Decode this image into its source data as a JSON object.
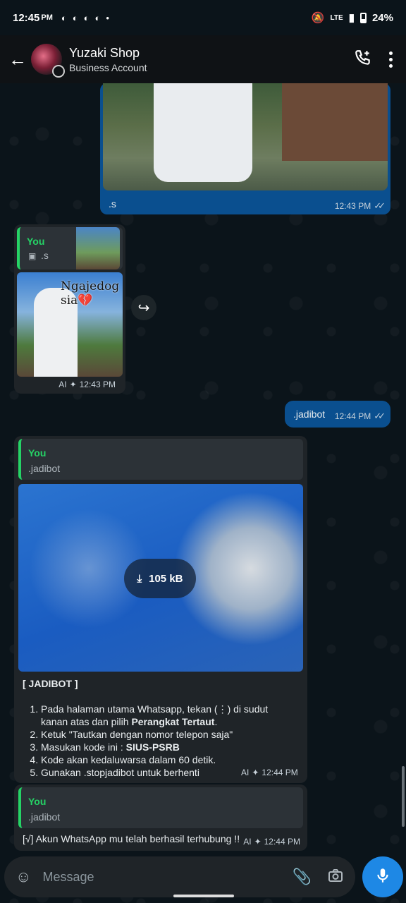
{
  "status": {
    "time": "12:45",
    "ampm": "PM",
    "battery": "24%",
    "network": "LTE"
  },
  "header": {
    "name": "Yuzaki Shop",
    "subtitle": "Business Account"
  },
  "messages": {
    "m1": {
      "caption": ".s",
      "time": "12:43 PM"
    },
    "m2": {
      "quote_who": "You",
      "quote_text": ".s",
      "image_text": "Ngajedog sia💔",
      "meta_ai": "AI",
      "time": "12:43 PM"
    },
    "m3": {
      "text": ".jadibot",
      "time": "12:44 PM"
    },
    "m4": {
      "quote_who": "You",
      "quote_text": ".jadibot",
      "download_size": "105 kB",
      "title": "[ JADIBOT ]",
      "steps": [
        {
          "pre": "Pada halaman utama Whatsapp, tekan (⋮) di sudut kanan atas dan pilih ",
          "bold": "Perangkat Tertaut",
          "post": "."
        },
        {
          "pre": "Ketuk \"Tautkan dengan nomor telepon saja\"",
          "bold": "",
          "post": ""
        },
        {
          "pre": "Masukan kode ini : ",
          "bold": "SIUS-PSRB",
          "post": ""
        },
        {
          "pre": "Kode akan kedaluwarsa dalam 60 detik.",
          "bold": "",
          "post": ""
        },
        {
          "pre": "Gunakan .stopjadibot untuk berhenti",
          "bold": "",
          "post": ""
        }
      ],
      "meta_ai": "AI",
      "time": "12:44 PM"
    },
    "m5": {
      "quote_who": "You",
      "quote_text": ".jadibot",
      "text": "[√] Akun WhatsApp mu telah berhasil terhubung !!",
      "meta_ai": "AI",
      "time": "12:44 PM"
    }
  },
  "input": {
    "placeholder": "Message"
  },
  "colors": {
    "accent": "#25d366",
    "outgoing": "#0a4f8f",
    "incoming": "#1f2428",
    "mic": "#1e88e5"
  }
}
